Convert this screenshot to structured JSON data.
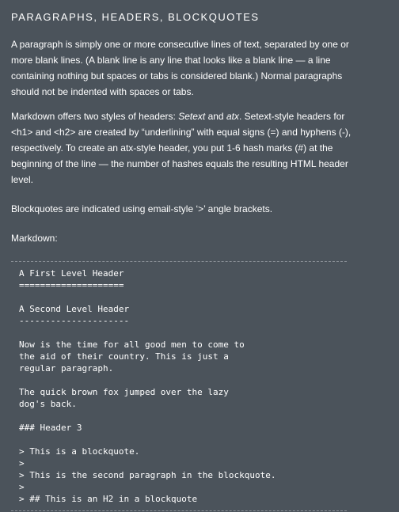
{
  "section_title": "PARAGRAPHS, HEADERS, BLOCKQUOTES",
  "paragraph_1": "A paragraph is simply one or more consecutive lines of text, separated by one or more blank lines. (A blank line is any line that looks like a blank line — a line containing nothing but spaces or tabs is considered blank.) Normal paragraphs should not be indented with spaces or tabs.",
  "paragraph_2": {
    "part_1": "Markdown offers two styles of headers: ",
    "setext": "Setext",
    "part_2": " and ",
    "atx": "atx",
    "part_3": ". Setext-style headers for <h1> and <h2> are created by “underlining” with equal signs (=) and hyphens (-), respectively. To create an atx-style header, you put 1-6 hash marks (#) at the beginning of the line — the number of hashes equals the resulting HTML header level."
  },
  "paragraph_3": "Blockquotes are indicated using email-style ‘>’ angle brackets.",
  "markdown_label": "Markdown:",
  "code_lines": [
    "A First Level Header",
    "====================",
    "A Second Level Header",
    "---------------------",
    "Now is the time for all good men to come to",
    "the aid of their country. This is just a",
    "regular paragraph.",
    "The quick brown fox jumped over the lazy",
    "dog's back.",
    "### Header 3",
    "> This is a blockquote.",
    ">",
    "> This is the second paragraph in the blockquote.",
    ">",
    "> ## This is an H2 in a blockquote"
  ]
}
